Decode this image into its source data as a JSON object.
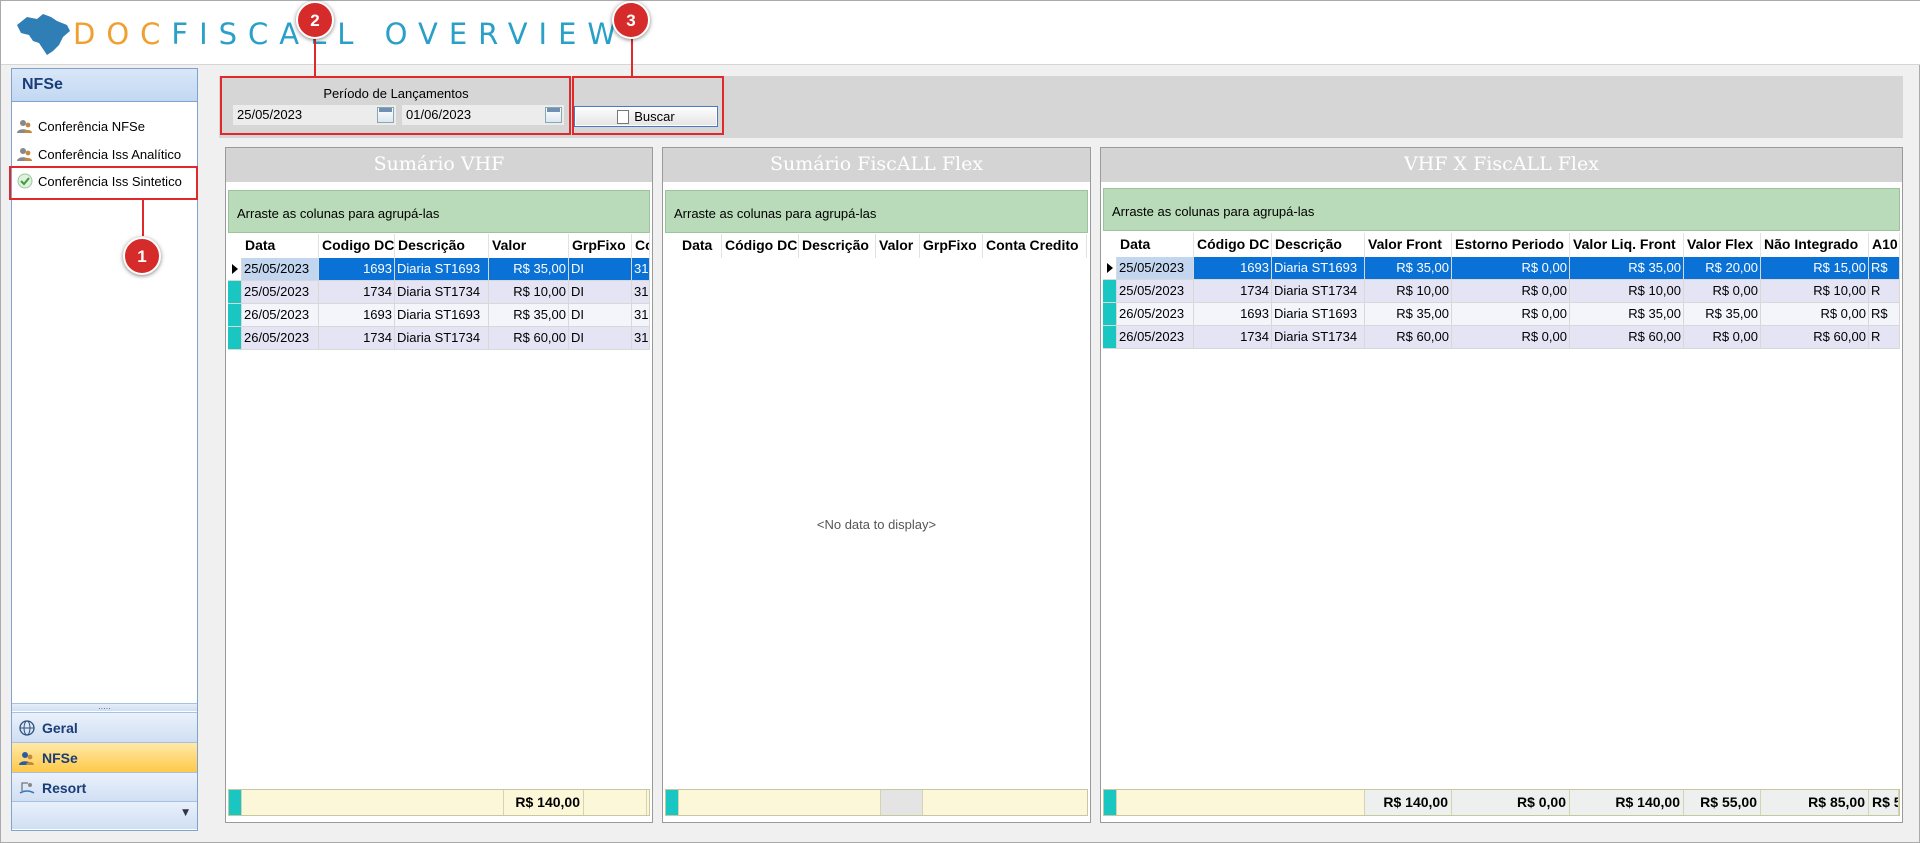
{
  "header": {
    "logo_doc": "DOC",
    "logo_fiscall": "FISCALL",
    "logo_overview": "OVERVIEW"
  },
  "sidebar": {
    "title": "NFSe",
    "items": [
      {
        "label": "Conferência NFSe",
        "icon": "users-icon"
      },
      {
        "label": "Conferência Iss Analítico",
        "icon": "users-icon"
      },
      {
        "label": "Conferência Iss Sintetico",
        "icon": "check-icon"
      }
    ],
    "grip": ".....",
    "nav": [
      {
        "label": "Geral",
        "icon": "globe-icon"
      },
      {
        "label": "NFSe",
        "icon": "users-icon",
        "active": true
      },
      {
        "label": "Resort",
        "icon": "resort-icon"
      }
    ]
  },
  "toolbar": {
    "period_label": "Período de Lançamentos",
    "date_from": "25/05/2023",
    "date_to": "01/06/2023",
    "search_label": "Buscar"
  },
  "panels": {
    "vhf": {
      "title": "Sumário VHF",
      "group_hint": "Arraste as colunas para agrupá-las",
      "columns": [
        "Data",
        "Codigo DC",
        "Descrição",
        "Valor",
        "GrpFixo",
        "Co"
      ],
      "rows": [
        [
          "25/05/2023",
          "1693",
          "Diaria ST1693",
          "R$ 35,00",
          "DI",
          "31"
        ],
        [
          "25/05/2023",
          "1734",
          "Diaria ST1734",
          "R$ 10,00",
          "DI",
          "31"
        ],
        [
          "26/05/2023",
          "1693",
          "Diaria ST1693",
          "R$ 35,00",
          "DI",
          "31"
        ],
        [
          "26/05/2023",
          "1734",
          "Diaria ST1734",
          "R$ 60,00",
          "DI",
          "31"
        ]
      ],
      "total": "R$ 140,00"
    },
    "fiscall": {
      "title": "Sumário FiscALL Flex",
      "group_hint": "Arraste as colunas para agrupá-las",
      "columns": [
        "Data",
        "Código DC",
        "Descrição",
        "Valor",
        "GrpFixo",
        "Conta Credito"
      ],
      "empty_text": "<No data to display>"
    },
    "compare": {
      "title": "VHF X FiscALL Flex",
      "group_hint": "Arraste as colunas para agrupá-las",
      "columns": [
        "Data",
        "Código DC",
        "Descrição",
        "Valor Front",
        "Estorno Periodo",
        "Valor Liq. Front",
        "Valor Flex",
        "Não Integrado",
        "A10"
      ],
      "rows": [
        [
          "25/05/2023",
          "1693",
          "Diaria ST1693",
          "R$ 35,00",
          "R$ 0,00",
          "R$ 35,00",
          "R$ 20,00",
          "R$ 15,00",
          "R$"
        ],
        [
          "25/05/2023",
          "1734",
          "Diaria ST1734",
          "R$ 10,00",
          "R$ 0,00",
          "R$ 10,00",
          "R$ 0,00",
          "R$ 10,00",
          "R"
        ],
        [
          "26/05/2023",
          "1693",
          "Diaria ST1693",
          "R$ 35,00",
          "R$ 0,00",
          "R$ 35,00",
          "R$ 35,00",
          "R$ 0,00",
          "R$"
        ],
        [
          "26/05/2023",
          "1734",
          "Diaria ST1734",
          "R$ 60,00",
          "R$ 0,00",
          "R$ 60,00",
          "R$ 0,00",
          "R$ 60,00",
          "R"
        ]
      ],
      "totals": [
        "R$ 140,00",
        "R$ 0,00",
        "R$ 140,00",
        "R$ 55,00",
        "R$ 85,00",
        "R$ 5"
      ]
    }
  },
  "callouts": [
    "1",
    "2",
    "3"
  ],
  "colors": {
    "group_bar": "#b9dbb9",
    "selection": "#0a72d6",
    "row_indicator": "#1ac6c2",
    "callout": "#e0292a",
    "nav_active": "#ffc94a"
  }
}
